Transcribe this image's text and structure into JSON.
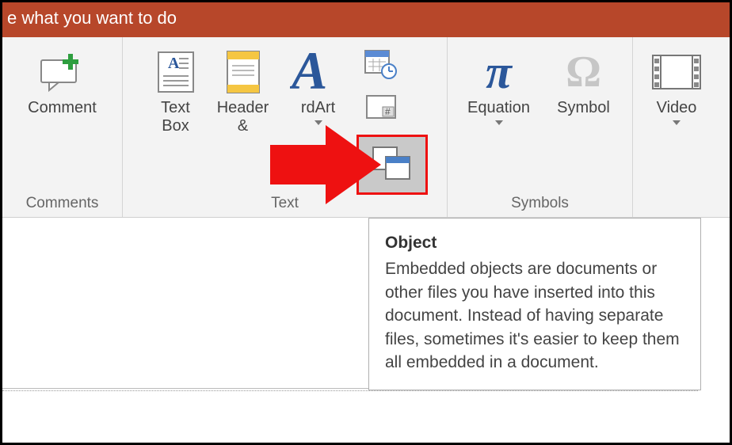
{
  "titlebar": {
    "text": "e what you want to do"
  },
  "groups": {
    "comments": {
      "label": "Comments",
      "comment_btn": "Comment"
    },
    "text": {
      "label": "Text",
      "textbox": "Text\nBox",
      "header": "Header\n&",
      "wordart": "rdArt"
    },
    "symbols": {
      "label": "Symbols",
      "equation": "Equation",
      "symbol": "Symbol"
    },
    "media": {
      "video": "Video"
    }
  },
  "tooltip": {
    "title": "Object",
    "body": "Embedded objects are documents or other files you have inserted into this document. Instead of having separate files, sometimes it's easier to keep them all embedded in a document."
  }
}
